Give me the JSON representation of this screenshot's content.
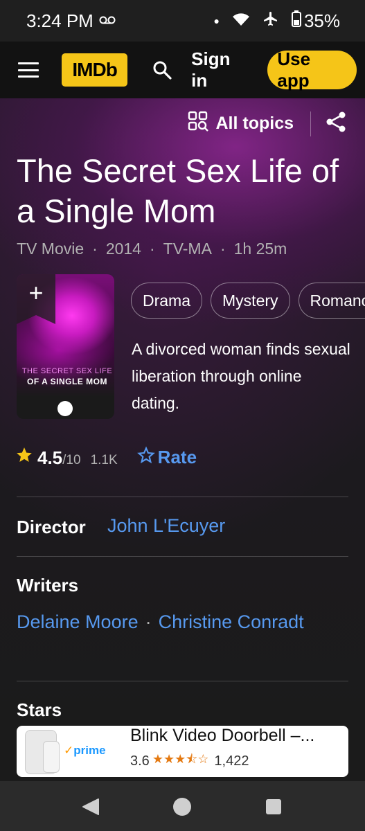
{
  "status_bar": {
    "time": "3:24 PM",
    "voicemail_icon": "voicemail-icon",
    "battery": "35%",
    "icons": [
      "notification-dot-icon",
      "wifi-icon",
      "airplane-icon",
      "battery-icon"
    ]
  },
  "header": {
    "logo": "IMDb",
    "signin_label": "Sign in",
    "use_app_label": "Use app",
    "brand_color": "#f5c518"
  },
  "hero": {
    "all_topics_label": "All topics",
    "title": "The Secret Sex Life of a Single Mom",
    "meta": [
      "TV Movie",
      "2014",
      "TV-MA",
      "1h 25m"
    ],
    "poster": {
      "add_symbol": "+",
      "title_line1": "THE SECRET SEX LIFE",
      "title_line2": "OF A SINGLE MOM"
    },
    "genres": [
      "Drama",
      "Mystery",
      "Romance"
    ],
    "plot": "A divorced woman finds sexual liberation through online dating.",
    "rating": {
      "value": "4.5",
      "max": "/10",
      "count": "1.1K",
      "rate_label": "Rate"
    },
    "director_label": "Director",
    "director_name": "John L'Ecuyer",
    "writers_label": "Writers",
    "writers": [
      "Delaine Moore",
      "Christine Conradt"
    ],
    "stars_label": "Stars",
    "link_color": "#5799ef"
  },
  "ad": {
    "badge": "prime",
    "title": "Blink Video Doorbell –...",
    "rating_value": "3.6",
    "stars": "★★★⯪☆",
    "review_count": "1,422"
  }
}
